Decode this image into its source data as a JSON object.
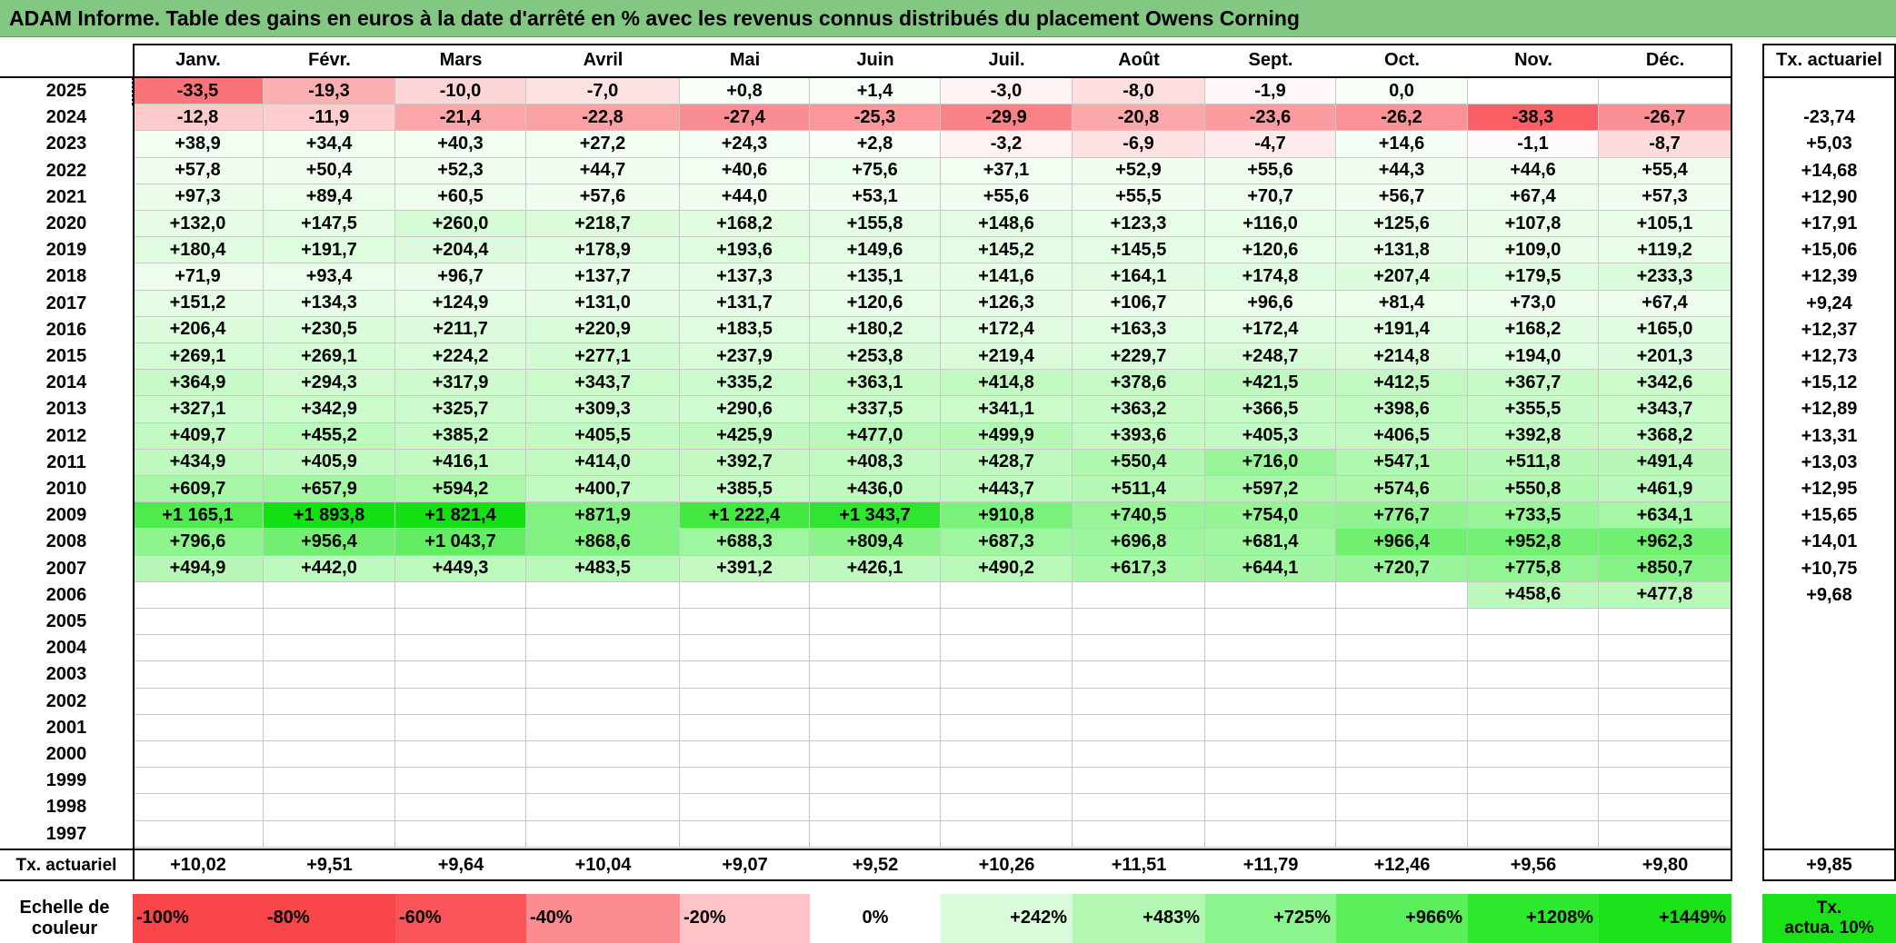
{
  "title": "ADAM Informe. Table des gains en euros à la date d'arrêté en % avec les revenus connus distribués du placement Owens Corning",
  "months": [
    "Janv.",
    "Févr.",
    "Mars",
    "Avril",
    "Mai",
    "Juin",
    "Juil.",
    "Août",
    "Sept.",
    "Oct.",
    "Nov.",
    "Déc."
  ],
  "actuarial_header": "Tx. actuariel",
  "rows": [
    {
      "year": "2025",
      "values": [
        "-33,5",
        "-19,3",
        "-10,0",
        "-7,0",
        "+0,8",
        "+1,4",
        "-3,0",
        "-8,0",
        "-1,9",
        "0,0",
        "",
        ""
      ],
      "rate": ""
    },
    {
      "year": "2024",
      "values": [
        "-12,8",
        "-11,9",
        "-21,4",
        "-22,8",
        "-27,4",
        "-25,3",
        "-29,9",
        "-20,8",
        "-23,6",
        "-26,2",
        "-38,3",
        "-26,7"
      ],
      "rate": "-23,74"
    },
    {
      "year": "2023",
      "values": [
        "+38,9",
        "+34,4",
        "+40,3",
        "+27,2",
        "+24,3",
        "+2,8",
        "-3,2",
        "-6,9",
        "-4,7",
        "+14,6",
        "-1,1",
        "-8,7"
      ],
      "rate": "+5,03"
    },
    {
      "year": "2022",
      "values": [
        "+57,8",
        "+50,4",
        "+52,3",
        "+44,7",
        "+40,6",
        "+75,6",
        "+37,1",
        "+52,9",
        "+55,6",
        "+44,3",
        "+44,6",
        "+55,4"
      ],
      "rate": "+14,68"
    },
    {
      "year": "2021",
      "values": [
        "+97,3",
        "+89,4",
        "+60,5",
        "+57,6",
        "+44,0",
        "+53,1",
        "+55,6",
        "+55,5",
        "+70,7",
        "+56,7",
        "+67,4",
        "+57,3"
      ],
      "rate": "+12,90"
    },
    {
      "year": "2020",
      "values": [
        "+132,0",
        "+147,5",
        "+260,0",
        "+218,7",
        "+168,2",
        "+155,8",
        "+148,6",
        "+123,3",
        "+116,0",
        "+125,6",
        "+107,8",
        "+105,1"
      ],
      "rate": "+17,91"
    },
    {
      "year": "2019",
      "values": [
        "+180,4",
        "+191,7",
        "+204,4",
        "+178,9",
        "+193,6",
        "+149,6",
        "+145,2",
        "+145,5",
        "+120,6",
        "+131,8",
        "+109,0",
        "+119,2"
      ],
      "rate": "+15,06"
    },
    {
      "year": "2018",
      "values": [
        "+71,9",
        "+93,4",
        "+96,7",
        "+137,7",
        "+137,3",
        "+135,1",
        "+141,6",
        "+164,1",
        "+174,8",
        "+207,4",
        "+179,5",
        "+233,3"
      ],
      "rate": "+12,39"
    },
    {
      "year": "2017",
      "values": [
        "+151,2",
        "+134,3",
        "+124,9",
        "+131,0",
        "+131,7",
        "+120,6",
        "+126,3",
        "+106,7",
        "+96,6",
        "+81,4",
        "+73,0",
        "+67,4"
      ],
      "rate": "+9,24"
    },
    {
      "year": "2016",
      "values": [
        "+206,4",
        "+230,5",
        "+211,7",
        "+220,9",
        "+183,5",
        "+180,2",
        "+172,4",
        "+163,3",
        "+172,4",
        "+191,4",
        "+168,2",
        "+165,0"
      ],
      "rate": "+12,37"
    },
    {
      "year": "2015",
      "values": [
        "+269,1",
        "+269,1",
        "+224,2",
        "+277,1",
        "+237,9",
        "+253,8",
        "+219,4",
        "+229,7",
        "+248,7",
        "+214,8",
        "+194,0",
        "+201,3"
      ],
      "rate": "+12,73"
    },
    {
      "year": "2014",
      "values": [
        "+364,9",
        "+294,3",
        "+317,9",
        "+343,7",
        "+335,2",
        "+363,1",
        "+414,8",
        "+378,6",
        "+421,5",
        "+412,5",
        "+367,7",
        "+342,6"
      ],
      "rate": "+15,12"
    },
    {
      "year": "2013",
      "values": [
        "+327,1",
        "+342,9",
        "+325,7",
        "+309,3",
        "+290,6",
        "+337,5",
        "+341,1",
        "+363,2",
        "+366,5",
        "+398,6",
        "+355,5",
        "+343,7"
      ],
      "rate": "+12,89"
    },
    {
      "year": "2012",
      "values": [
        "+409,7",
        "+455,2",
        "+385,2",
        "+405,5",
        "+425,9",
        "+477,0",
        "+499,9",
        "+393,6",
        "+405,3",
        "+406,5",
        "+392,8",
        "+368,2"
      ],
      "rate": "+13,31"
    },
    {
      "year": "2011",
      "values": [
        "+434,9",
        "+405,9",
        "+416,1",
        "+414,0",
        "+392,7",
        "+408,3",
        "+428,7",
        "+550,4",
        "+716,0",
        "+547,1",
        "+511,8",
        "+491,4"
      ],
      "rate": "+13,03"
    },
    {
      "year": "2010",
      "values": [
        "+609,7",
        "+657,9",
        "+594,2",
        "+400,7",
        "+385,5",
        "+436,0",
        "+443,7",
        "+511,4",
        "+597,2",
        "+574,6",
        "+550,8",
        "+461,9"
      ],
      "rate": "+12,95"
    },
    {
      "year": "2009",
      "values": [
        "+1 165,1",
        "+1 893,8",
        "+1 821,4",
        "+871,9",
        "+1 222,4",
        "+1 343,7",
        "+910,8",
        "+740,5",
        "+754,0",
        "+776,7",
        "+733,5",
        "+634,1"
      ],
      "rate": "+15,65"
    },
    {
      "year": "2008",
      "values": [
        "+796,6",
        "+956,4",
        "+1 043,7",
        "+868,6",
        "+688,3",
        "+809,4",
        "+687,3",
        "+696,8",
        "+681,4",
        "+966,4",
        "+952,8",
        "+962,3"
      ],
      "rate": "+14,01"
    },
    {
      "year": "2007",
      "values": [
        "+494,9",
        "+442,0",
        "+449,3",
        "+483,5",
        "+391,2",
        "+426,1",
        "+490,2",
        "+617,3",
        "+644,1",
        "+720,7",
        "+775,8",
        "+850,7"
      ],
      "rate": "+10,75"
    },
    {
      "year": "2006",
      "values": [
        "",
        "",
        "",
        "",
        "",
        "",
        "",
        "",
        "",
        "",
        "+458,6",
        "+477,8"
      ],
      "rate": "+9,68"
    },
    {
      "year": "2005",
      "values": [
        "",
        "",
        "",
        "",
        "",
        "",
        "",
        "",
        "",
        "",
        "",
        ""
      ],
      "rate": ""
    },
    {
      "year": "2004",
      "values": [
        "",
        "",
        "",
        "",
        "",
        "",
        "",
        "",
        "",
        "",
        "",
        ""
      ],
      "rate": ""
    },
    {
      "year": "2003",
      "values": [
        "",
        "",
        "",
        "",
        "",
        "",
        "",
        "",
        "",
        "",
        "",
        ""
      ],
      "rate": ""
    },
    {
      "year": "2002",
      "values": [
        "",
        "",
        "",
        "",
        "",
        "",
        "",
        "",
        "",
        "",
        "",
        ""
      ],
      "rate": ""
    },
    {
      "year": "2001",
      "values": [
        "",
        "",
        "",
        "",
        "",
        "",
        "",
        "",
        "",
        "",
        "",
        ""
      ],
      "rate": ""
    },
    {
      "year": "2000",
      "values": [
        "",
        "",
        "",
        "",
        "",
        "",
        "",
        "",
        "",
        "",
        "",
        ""
      ],
      "rate": ""
    },
    {
      "year": "1999",
      "values": [
        "",
        "",
        "",
        "",
        "",
        "",
        "",
        "",
        "",
        "",
        "",
        ""
      ],
      "rate": ""
    },
    {
      "year": "1998",
      "values": [
        "",
        "",
        "",
        "",
        "",
        "",
        "",
        "",
        "",
        "",
        "",
        ""
      ],
      "rate": ""
    },
    {
      "year": "1997",
      "values": [
        "",
        "",
        "",
        "",
        "",
        "",
        "",
        "",
        "",
        "",
        "",
        ""
      ],
      "rate": ""
    }
  ],
  "footer": {
    "label": "Tx. actuariel",
    "values": [
      "+10,02",
      "+9,51",
      "+9,64",
      "+10,04",
      "+9,07",
      "+9,52",
      "+10,26",
      "+11,51",
      "+11,79",
      "+12,46",
      "+9,56",
      "+9,80"
    ],
    "overall": "+9,85"
  },
  "scale": {
    "label_line1": "Echelle de",
    "label_line2": "couleur",
    "items": [
      {
        "text": "-100%",
        "color": "#f8454a"
      },
      {
        "text": "-80%",
        "color": "#f8454a"
      },
      {
        "text": "-60%",
        "color": "#fa555a"
      },
      {
        "text": "-40%",
        "color": "#fb8c90"
      },
      {
        "text": "-20%",
        "color": "#fdc3c6"
      },
      {
        "text": "0%",
        "color": "#ffffff"
      },
      {
        "text": "+242%",
        "color": "#d9fbd9"
      },
      {
        "text": "+483%",
        "color": "#b2f7b2"
      },
      {
        "text": "+725%",
        "color": "#8cf48c"
      },
      {
        "text": "+966%",
        "color": "#5aee5a"
      },
      {
        "text": "+1208%",
        "color": "#2ee82e"
      },
      {
        "text": "+1449%",
        "color": "#19e219"
      }
    ],
    "rate_line1": "Tx.",
    "rate_line2": "actua. 10%",
    "rate_color": "#19e219"
  }
}
